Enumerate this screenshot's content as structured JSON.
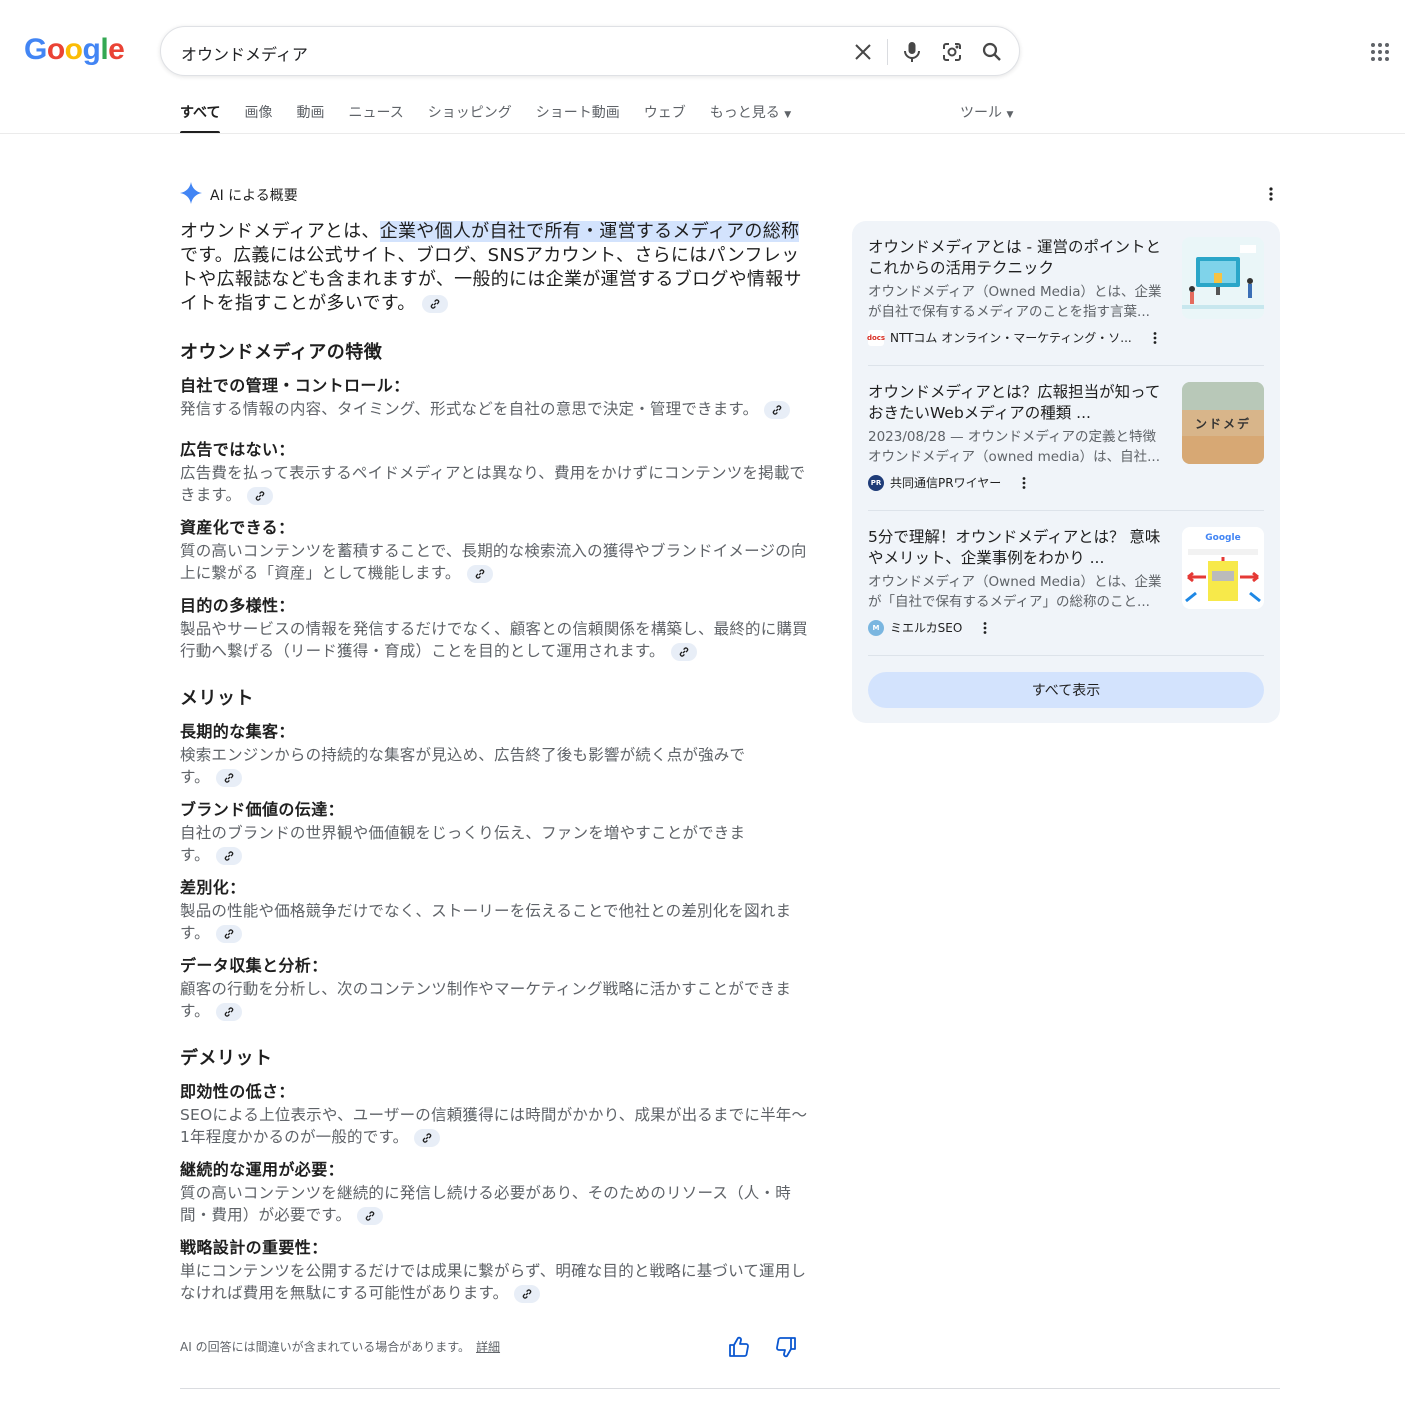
{
  "logo": {
    "g1": "G",
    "o1": "o",
    "o2": "o",
    "g2": "g",
    "l": "l",
    "e": "e"
  },
  "search": {
    "query": "オウンドメディア"
  },
  "tabs": [
    "すべて",
    "画像",
    "動画",
    "ニュース",
    "ショッピング",
    "ショート動画",
    "ウェブ",
    "もっと見る"
  ],
  "tools_label": "ツール",
  "ai": {
    "heading": "AI による概要",
    "intro_pre": "オウンドメディアとは、",
    "intro_hl": "企業や個人が自社で所有・運営するメディアの総称",
    "intro_post": "です。広義には公式サイト、ブログ、SNSアカウント、さらにはパンフレットや広報誌なども含まれますが、一般的には企業が運営するブログや情報サイトを指すことが多いです。",
    "sections": [
      {
        "title": "オウンドメディアの特徴",
        "items": [
          {
            "title": "自社での管理・コントロール：",
            "desc": "発信する情報の内容、タイミング、形式などを自社の意思で決定・管理できます。"
          },
          {
            "title": "広告ではない：",
            "desc": "広告費を払って表示するペイドメディアとは異なり、費用をかけずにコンテンツを掲載できます。"
          },
          {
            "title": "資産化できる：",
            "desc": "質の高いコンテンツを蓄積することで、長期的な検索流入の獲得やブランドイメージの向上に繋がる「資産」として機能します。"
          },
          {
            "title": "目的の多様性：",
            "desc": "製品やサービスの情報を発信するだけでなく、顧客との信頼関係を構築し、最終的に購買行動へ繋げる（リード獲得・育成）ことを目的として運用されます。"
          }
        ]
      },
      {
        "title": "メリット",
        "items": [
          {
            "title": "長期的な集客：",
            "desc": "検索エンジンからの持続的な集客が見込め、広告終了後も影響が続く点が強みです。"
          },
          {
            "title": "ブランド価値の伝達：",
            "desc": "自社のブランドの世界観や価値観をじっくり伝え、ファンを増やすことができます。"
          },
          {
            "title": "差別化：",
            "desc": "製品の性能や価格競争だけでなく、ストーリーを伝えることで他社との差別化を図れます。"
          },
          {
            "title": "データ収集と分析：",
            "desc": "顧客の行動を分析し、次のコンテンツ制作やマーケティング戦略に活かすことができます。"
          }
        ]
      },
      {
        "title": "デメリット",
        "items": [
          {
            "title": "即効性の低さ：",
            "desc": "SEOによる上位表示や、ユーザーの信頼獲得には時間がかかり、成果が出るまでに半年〜1年程度かかるのが一般的です。"
          },
          {
            "title": "継続的な運用が必要：",
            "desc": "質の高いコンテンツを継続的に発信し続ける必要があり、そのためのリソース（人・時間・費用）が必要です。"
          },
          {
            "title": "戦略設計の重要性：",
            "desc": "単にコンテンツを公開するだけでは成果に繋がらず、明確な目的と戦略に基づいて運用しなければ費用を無駄にする可能性があります。"
          }
        ]
      }
    ],
    "disclaimer": "AI の回答には間違いが含まれている場合があります。",
    "detail_link": "詳細"
  },
  "sources": [
    {
      "title": "オウンドメディアとは - 運営のポイントとこれからの活用テクニック",
      "snippet": "オウンドメディア（Owned Media）とは、企業が自社で保有するメディアのことを指す言葉...",
      "site": "NTTコム オンライン・マーケティング・ソ...",
      "fav": "docs"
    },
    {
      "title": "オウンドメディアとは？広報担当が知っておきたいWebメディアの種類 ...",
      "snippet": "2023/08/28 — オウンドメディアの定義と特徴 オウンドメディア（owned media）は、自社...",
      "site": "共同通信PRワイヤー",
      "fav": "PR",
      "thumb_text": "ンドメデ"
    },
    {
      "title": "5分で理解！オウンドメディアとは？ 意味やメリット、企業事例をわかり ...",
      "snippet": "オウンドメディア（Owned Media）とは、企業が「自社で保有するメディア」の総称のこと...",
      "site": "ミエルカSEO",
      "fav": "M",
      "thumb_brand": "Google"
    }
  ],
  "show_all": "すべて表示",
  "colors": {
    "blue": "#4285f4",
    "red": "#ea4335",
    "yellow": "#fbbc05",
    "green": "#34a853",
    "highlight": "#d3e3fd",
    "card_bg": "#f0f4f9"
  }
}
